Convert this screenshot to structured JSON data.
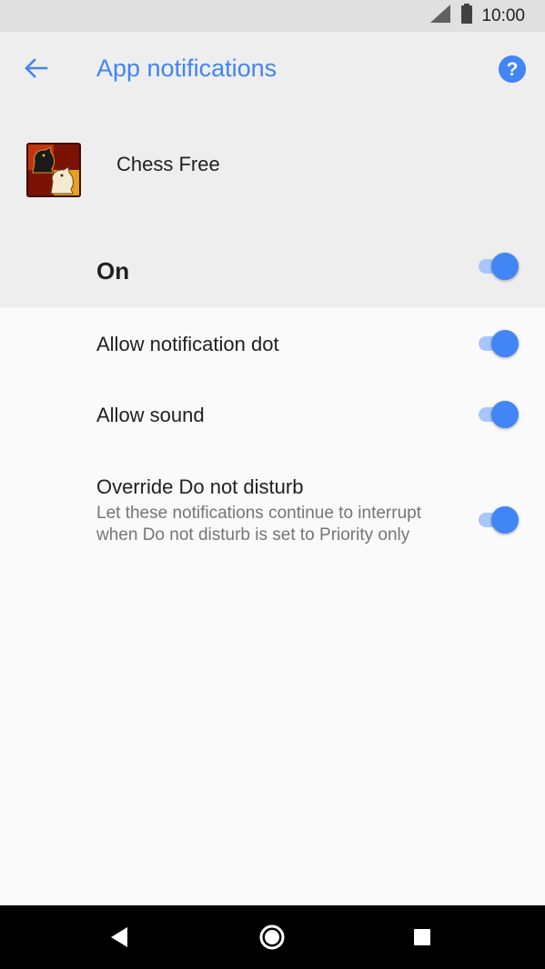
{
  "status_bar": {
    "time": "10:00",
    "icons": [
      "signal-icon",
      "battery-icon"
    ]
  },
  "app_bar": {
    "title": "App notifications",
    "back_icon": "arrow-back-icon",
    "help_icon": "help-icon"
  },
  "app": {
    "name": "Chess Free",
    "icon": "chess-knight-icon"
  },
  "main_toggle": {
    "label": "On",
    "checked": true
  },
  "settings": [
    {
      "label": "Allow notification dot",
      "checked": true
    },
    {
      "label": "Allow sound",
      "checked": true
    },
    {
      "label": "Override Do not disturb",
      "summary": "Let these notifications continue to interrupt when Do not disturb is set to Priority only",
      "checked": true
    }
  ],
  "nav_bar": {
    "icons": [
      "back-triangle-icon",
      "home-circle-icon",
      "recents-square-icon"
    ]
  },
  "colors": {
    "accent": "#4285f4",
    "switch_track": "#a8c6fa",
    "header_bg": "#eeeeee",
    "body_bg": "#fafafa"
  }
}
